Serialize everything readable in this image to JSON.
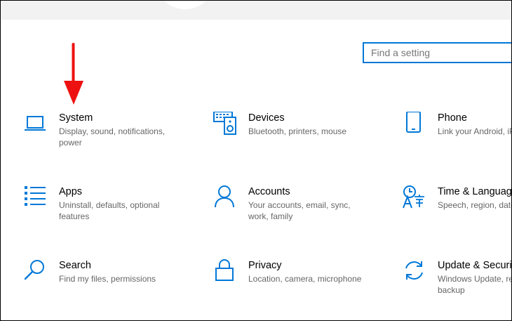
{
  "search": {
    "placeholder": "Find a setting"
  },
  "tiles": [
    {
      "title": "System",
      "desc_lines": [
        "Display, sound, notifications,",
        "power"
      ],
      "icon": "laptop-icon"
    },
    {
      "title": "Devices",
      "desc_lines": [
        "Bluetooth, printers, mouse"
      ],
      "icon": "devices-icon"
    },
    {
      "title": "Phone",
      "desc_lines": [
        "Link your Android, iP"
      ],
      "icon": "phone-icon"
    },
    {
      "title": "Apps",
      "desc_lines": [
        "Uninstall, defaults, optional",
        "features"
      ],
      "icon": "apps-list-icon"
    },
    {
      "title": "Accounts",
      "desc_lines": [
        "Your accounts, email, sync,",
        "work, family"
      ],
      "icon": "person-icon"
    },
    {
      "title": "Time & Language",
      "desc_lines": [
        "Speech, region, date"
      ],
      "icon": "time-language-icon"
    },
    {
      "title": "Search",
      "desc_lines": [
        "Find my files, permissions"
      ],
      "icon": "search-icon"
    },
    {
      "title": "Privacy",
      "desc_lines": [
        "Location, camera, microphone"
      ],
      "icon": "lock-icon"
    },
    {
      "title": "Update & Security",
      "desc_lines": [
        "Windows Update, reco",
        "backup"
      ],
      "icon": "update-icon"
    }
  ],
  "colors": {
    "accent": "#0078d7",
    "annotation_arrow": "#ee1111",
    "title_text": "#000000",
    "desc_text": "#666666"
  }
}
